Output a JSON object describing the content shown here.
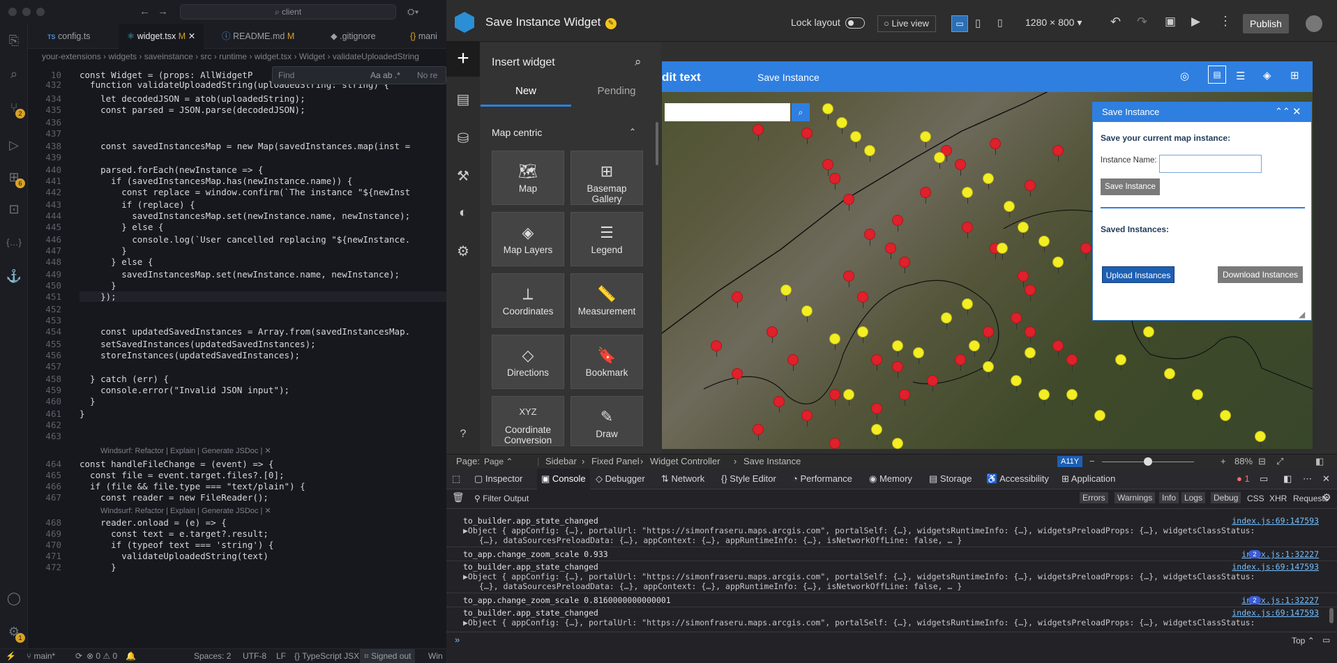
{
  "vscode": {
    "search": "client",
    "tabs": [
      "config.ts",
      "widget.tsx",
      "README.md",
      ".gitignore",
      "mani"
    ],
    "tab_status": [
      "M",
      "M"
    ],
    "tab_prefixes": [
      "TS",
      "{}"
    ],
    "breadcrumb": "your-extensions › widgets › saveinstance › src › runtime › widget.tsx › Widget › validateUploadedString",
    "find_placeholder": "Find",
    "find_result": "No re",
    "find_options": [
      "Aa",
      "ab",
      ".*"
    ],
    "badges": [
      "2",
      "6",
      "1"
    ],
    "code_lines": [
      {
        "n": "10",
        "t": "const Widget = (props: AllWidgetP"
      },
      {
        "n": "432",
        "t": "  function validateUploadedString(uploadedString: string) {"
      },
      {
        "n": "434",
        "t": "    let decodedJSON = atob(uploadedString);"
      },
      {
        "n": "435",
        "t": "    const parsed = JSON.parse(decodedJSON);"
      },
      {
        "n": "436",
        "t": ""
      },
      {
        "n": "437",
        "t": ""
      },
      {
        "n": "438",
        "t": "    const savedInstancesMap = new Map(savedInstances.map(inst ="
      },
      {
        "n": "439",
        "t": ""
      },
      {
        "n": "440",
        "t": "    parsed.forEach(newInstance => {"
      },
      {
        "n": "441",
        "t": "      if (savedInstancesMap.has(newInstance.name)) {"
      },
      {
        "n": "442",
        "t": "        const replace = window.confirm(`The instance \"${newInst"
      },
      {
        "n": "443",
        "t": "        if (replace) {"
      },
      {
        "n": "444",
        "t": "          savedInstancesMap.set(newInstance.name, newInstance);"
      },
      {
        "n": "445",
        "t": "        } else {"
      },
      {
        "n": "446",
        "t": "          console.log(`User cancelled replacing \"${newInstance."
      },
      {
        "n": "447",
        "t": "        }"
      },
      {
        "n": "448",
        "t": "      } else {"
      },
      {
        "n": "449",
        "t": "        savedInstancesMap.set(newInstance.name, newInstance);"
      },
      {
        "n": "450",
        "t": "      }"
      },
      {
        "n": "451",
        "t": "    });"
      },
      {
        "n": "452",
        "t": ""
      },
      {
        "n": "453",
        "t": ""
      },
      {
        "n": "454",
        "t": "    const updatedSavedInstances = Array.from(savedInstancesMap."
      },
      {
        "n": "455",
        "t": "    setSavedInstances(updatedSavedInstances);"
      },
      {
        "n": "456",
        "t": "    storeInstances(updatedSavedInstances);"
      },
      {
        "n": "457",
        "t": ""
      },
      {
        "n": "458",
        "t": "  } catch (err) {"
      },
      {
        "n": "459",
        "t": "    console.error(\"Invalid JSON input\");"
      },
      {
        "n": "460",
        "t": "  }"
      },
      {
        "n": "461",
        "t": "}"
      },
      {
        "n": "462",
        "t": ""
      },
      {
        "n": "463",
        "t": ""
      },
      {
        "n": "464",
        "t": "const handleFileChange = (event) => {"
      },
      {
        "n": "465",
        "t": "  const file = event.target.files?.[0];"
      },
      {
        "n": "466",
        "t": "  if (file && file.type === \"text/plain\") {"
      },
      {
        "n": "467",
        "t": "    const reader = new FileReader();"
      },
      {
        "n": "468",
        "t": "    reader.onload = (e) => {"
      },
      {
        "n": "469",
        "t": "      const text = e.target?.result;"
      },
      {
        "n": "470",
        "t": "      if (typeof text === 'string') {"
      },
      {
        "n": "471",
        "t": "        validateUploadedString(text)"
      },
      {
        "n": "472",
        "t": "      }"
      }
    ],
    "codelens": "Windsurf: Refactor | Explain | Generate JSDoc | ✕",
    "status": {
      "branch": "main*",
      "problems": "⊗ 0 ⚠ 0",
      "spaces": "Spaces: 2",
      "enc": "UTF-8",
      "eol": "LF",
      "lang": "{} TypeScript JSX",
      "signed": "Signed out",
      "win": "Win"
    }
  },
  "builder": {
    "app_title": "Save Instance Widget",
    "lock_layout": "Lock layout",
    "live_view": "Live view",
    "resolution": "1280 × 800",
    "publish": "Publish",
    "insert_title": "Insert widget",
    "tabs": [
      "New",
      "Pending"
    ],
    "section": "Map centric",
    "widgets": [
      "Map",
      "Basemap Gallery",
      "Map Layers",
      "Legend",
      "Coordinates",
      "Measurement",
      "Directions",
      "Bookmark",
      "Coordinate Conversion",
      "Draw"
    ],
    "map_header": {
      "left": "dit text",
      "title": "Save Instance"
    },
    "panel": {
      "title": "Save Instance",
      "save_label": "Save your current map instance:",
      "name_label": "Instance Name:",
      "name_value": "",
      "save_btn": "Save Instance",
      "saved_label": "Saved Instances:",
      "upload_btn": "Upload Instances",
      "download_btn": "Download Instances"
    },
    "bottom": {
      "page_label": "Page:",
      "page_value": "Page",
      "crumbs": [
        "Sidebar",
        "Fixed Panel",
        "Widget Controller",
        "Save Instance"
      ],
      "a11y": "A11Y",
      "zoom": "88%"
    }
  },
  "devtools": {
    "tabs": [
      "Inspector",
      "Console",
      "Debugger",
      "Network",
      "Style Editor",
      "Performance",
      "Memory",
      "Storage",
      "Accessibility",
      "Application"
    ],
    "error_count": "1",
    "filter_placeholder": "Filter Output",
    "levels": [
      "Errors",
      "Warnings",
      "Info",
      "Logs",
      "Debug"
    ],
    "types": [
      "CSS",
      "XHR",
      "Requests"
    ],
    "rows": [
      {
        "msg": "to_builder.app_state_changed",
        "src": "index.js:69:147593",
        "count": ""
      },
      {
        "msg": "▶Object { appConfig: {…}, portalUrl: \"https://simonfraseru.maps.arcgis.com\", portalSelf: {…}, widgetsRuntimeInfo: {…}, widgetsPreloadProps: {…}, widgetsClassStatus:",
        "src": "",
        "count": ""
      },
      {
        "msg": " {…}, dataSourcesPreloadData: {…}, appContext: {…}, appRuntimeInfo: {…}, isNetworkOffLine: false, … }",
        "src": "",
        "count": ""
      },
      {
        "msg": "to_app.change_zoom_scale 0.933",
        "src": "index.js:1:32227",
        "count": "2"
      },
      {
        "msg": "to_builder.app_state_changed",
        "src": "index.js:69:147593",
        "count": ""
      },
      {
        "msg": "▶Object { appConfig: {…}, portalUrl: \"https://simonfraseru.maps.arcgis.com\", portalSelf: {…}, widgetsRuntimeInfo: {…}, widgetsPreloadProps: {…}, widgetsClassStatus:",
        "src": "",
        "count": ""
      },
      {
        "msg": " {…}, dataSourcesPreloadData: {…}, appContext: {…}, appRuntimeInfo: {…}, isNetworkOffLine: false, … }",
        "src": "",
        "count": ""
      },
      {
        "msg": "to_app.change_zoom_scale 0.8160000000000001",
        "src": "index.js:1:32227",
        "count": "2"
      },
      {
        "msg": "to_builder.app_state_changed",
        "src": "index.js:69:147593",
        "count": ""
      },
      {
        "msg": "▶Object { appConfig: {…}, portalUrl: \"https://simonfraseru.maps.arcgis.com\", portalSelf: {…}, widgetsRuntimeInfo: {…}, widgetsPreloadProps: {…}, widgetsClassStatus:",
        "src": "",
        "count": ""
      }
    ],
    "prompt": "»",
    "top": "Top"
  },
  "colors": {
    "accent": "#2f7fe0",
    "pin_red": "#e0202a",
    "pin_yellow": "#f3ee22",
    "btn_grey": "#7a7a7a",
    "btn_blue": "#1d5fb3"
  }
}
